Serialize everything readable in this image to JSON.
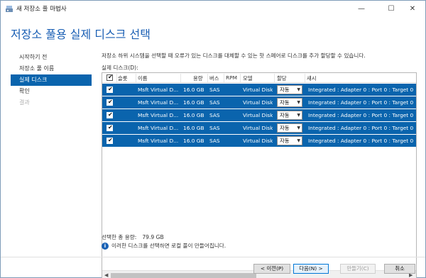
{
  "window": {
    "title": "새 저장소 풀 마법사"
  },
  "header": {
    "title": "저장소 풀용 실제 디스크 선택"
  },
  "nav": [
    {
      "label": "시작하기 전"
    },
    {
      "label": "저장소 풀 이름"
    },
    {
      "label": "실제 디스크"
    },
    {
      "label": "확인"
    },
    {
      "label": "결과"
    }
  ],
  "main": {
    "description": "저장소 하위 시스템을 선택할 때 오류가 있는 디스크를 대체할 수 있는 핫 스페어로 디스크를 추가 할당할 수 있습니다.",
    "grid_label": "실제 디스크(D):",
    "columns": [
      "슬롯",
      "이름",
      "용량",
      "버스",
      "RPM",
      "모델",
      "할당",
      "섀시"
    ],
    "rows": [
      {
        "name": "Msft Virtual D...",
        "capacity": "16.0 GB",
        "bus": "SAS",
        "rpm": "",
        "model": "Virtual Disk",
        "alloc": "자동",
        "chassis": "Integrated : Adapter 0 : Port 0 : Target 0"
      },
      {
        "name": "Msft Virtual D...",
        "capacity": "16.0 GB",
        "bus": "SAS",
        "rpm": "",
        "model": "Virtual Disk",
        "alloc": "자동",
        "chassis": "Integrated : Adapter 0 : Port 0 : Target 0"
      },
      {
        "name": "Msft Virtual D...",
        "capacity": "16.0 GB",
        "bus": "SAS",
        "rpm": "",
        "model": "Virtual Disk",
        "alloc": "자동",
        "chassis": "Integrated : Adapter 0 : Port 0 : Target 0"
      },
      {
        "name": "Msft Virtual D...",
        "capacity": "16.0 GB",
        "bus": "SAS",
        "rpm": "",
        "model": "Virtual Disk",
        "alloc": "자동",
        "chassis": "Integrated : Adapter 0 : Port 0 : Target 0"
      },
      {
        "name": "Msft Virtual D...",
        "capacity": "16.0 GB",
        "bus": "SAS",
        "rpm": "",
        "model": "Virtual Disk",
        "alloc": "자동",
        "chassis": "Integrated : Adapter 0 : Port 0 : Target 0"
      }
    ],
    "total_label": "선택한 총 용량:",
    "total_value": "79.9 GB",
    "info": "이러한 디스크를 선택하면 로컬 풀이 만들어집니다."
  },
  "buttons": {
    "prev": "< 이전(P)",
    "next": "다음(N) >",
    "create": "만들기(C)",
    "cancel": "취소"
  },
  "colors": {
    "accent": "#0a64ad",
    "title": "#1a5fb4"
  }
}
